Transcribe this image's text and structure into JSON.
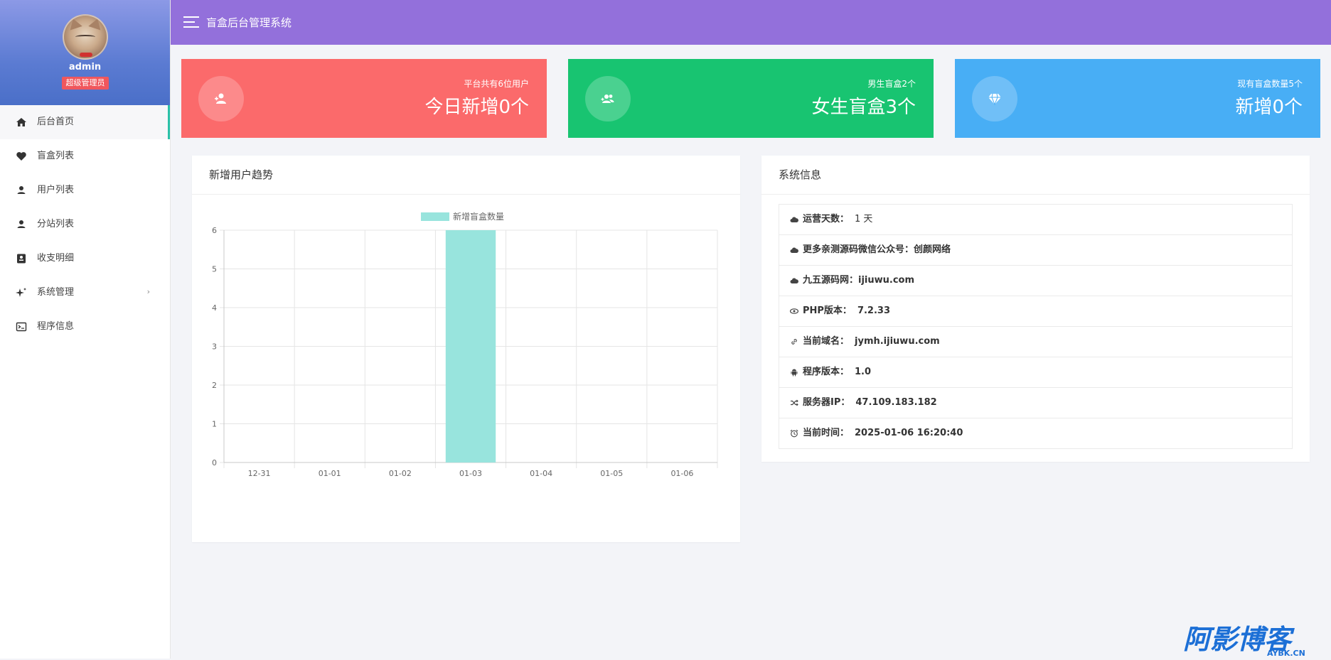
{
  "sidebar": {
    "admin_name": "admin",
    "role": "超级管理员",
    "items": [
      {
        "label": "后台首页",
        "icon": "home-icon",
        "active": true
      },
      {
        "label": "盲盒列表",
        "icon": "heart-icon"
      },
      {
        "label": "用户列表",
        "icon": "user-icon"
      },
      {
        "label": "分站列表",
        "icon": "user-icon"
      },
      {
        "label": "收支明细",
        "icon": "ledger-icon"
      },
      {
        "label": "系统管理",
        "icon": "sparkle-icon",
        "arrow": "›"
      },
      {
        "label": "程序信息",
        "icon": "terminal-icon"
      }
    ]
  },
  "header": {
    "title": "盲盒后台管理系统",
    "color": "#9370db"
  },
  "stats": [
    {
      "small": "平台共有6位用户",
      "big": "今日新增0个",
      "color": "#fb6a6b",
      "icon": "user-plus-icon"
    },
    {
      "small": "男生盲盒2个",
      "big": "女生盲盒3个",
      "color": "#18c471",
      "icon": "users-icon"
    },
    {
      "small": "现有盲盒数量5个",
      "big": "新增0个",
      "color": "#48aef5",
      "icon": "diamond-icon"
    }
  ],
  "chart_panel": {
    "title": "新增用户趋势"
  },
  "chart_data": {
    "type": "bar",
    "categories": [
      "12-31",
      "01-01",
      "01-02",
      "01-03",
      "01-04",
      "01-05",
      "01-06"
    ],
    "series": [
      {
        "name": "新增盲盒数量",
        "values": [
          0,
          0,
          0,
          6,
          0,
          0,
          0
        ],
        "color": "#98e4dd"
      }
    ],
    "ylim": [
      0,
      6
    ],
    "yticks": [
      "0",
      "1",
      "2",
      "3",
      "4",
      "5",
      "6"
    ],
    "legend": "top-center",
    "grid": true
  },
  "info_panel": {
    "title": "系统信息",
    "rows": [
      {
        "label": "运营天数：",
        "value": "1 天",
        "icon": "cloud-icon",
        "bold": false
      },
      {
        "label": "更多亲测源码微信公众号：",
        "value": "创颜网络",
        "icon": "cloud-icon",
        "bold": true
      },
      {
        "label": "九五源码网：",
        "value": "ijiuwu.com",
        "icon": "cloud-icon",
        "bold": true
      },
      {
        "label": "PHP版本：",
        "value": "7.2.33",
        "icon": "eye-icon",
        "bold": true
      },
      {
        "label": "当前域名：",
        "value": "jymh.ijiuwu.com",
        "icon": "link-icon",
        "bold": true
      },
      {
        "label": "程序版本：",
        "value": "1.0",
        "icon": "android-icon",
        "bold": true
      },
      {
        "label": "服务器IP：",
        "value": "47.109.183.182",
        "icon": "shuffle-icon",
        "bold": true
      },
      {
        "label": "当前时间：",
        "value": "2025-01-06 16:20:40",
        "icon": "alarm-icon",
        "bold": true
      }
    ]
  },
  "watermark": {
    "main": "阿影博客",
    "sub": "AYBK.CN"
  }
}
